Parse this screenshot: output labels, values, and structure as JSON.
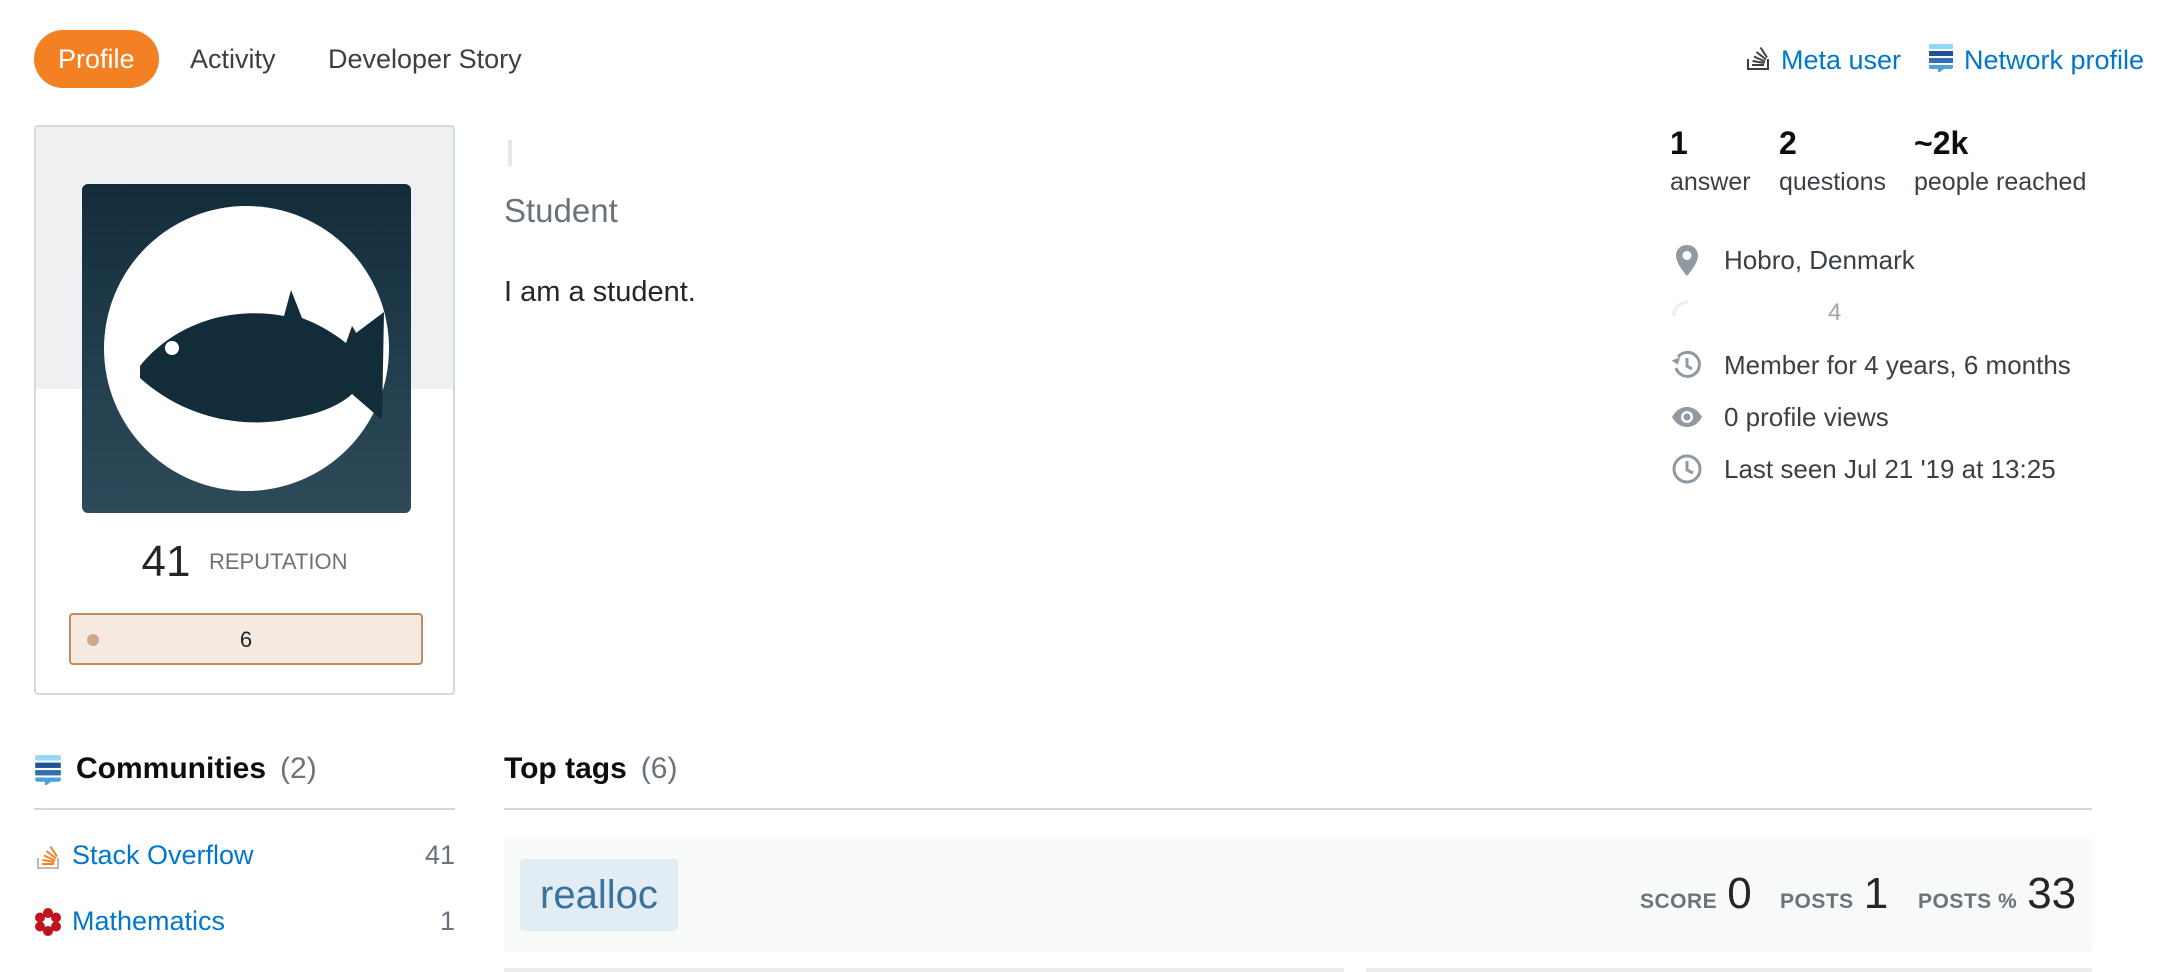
{
  "nav": {
    "tabs": [
      {
        "label": "Profile",
        "active": true
      },
      {
        "label": "Activity",
        "active": false
      },
      {
        "label": "Developer Story",
        "active": false
      }
    ],
    "meta_user": "Meta user",
    "network_profile": "Network profile"
  },
  "profile": {
    "title": "Student",
    "about": "I am a student.",
    "reputation": "41",
    "reputation_label": "REPUTATION",
    "bronze_badges": "6",
    "avatar_icon": "fish-icon"
  },
  "stats": [
    {
      "num": "1",
      "label": "answer"
    },
    {
      "num": "2",
      "label": "questions"
    },
    {
      "num": "~2k",
      "label": "people reached"
    }
  ],
  "info": {
    "location": "Hobro, Denmark",
    "website_partial": "4",
    "member_for": "Member for 4 years, 6 months",
    "profile_views": "0 profile views",
    "last_seen": "Last seen Jul 21 '19 at 13:25"
  },
  "communities": {
    "heading": "Communities",
    "count": "(2)",
    "items": [
      {
        "name": "Stack Overflow",
        "value": "41",
        "icon": "stackoverflow-icon"
      },
      {
        "name": "Mathematics",
        "value": "1",
        "icon": "mathematics-icon"
      }
    ]
  },
  "top_tags": {
    "heading": "Top tags",
    "count": "(6)",
    "items": [
      {
        "tag": "realloc",
        "score_label": "SCORE",
        "score": "0",
        "posts_label": "POSTS",
        "posts": "1",
        "posts_pct_label": "POSTS %",
        "posts_pct": "33"
      }
    ]
  },
  "colors": {
    "accent": "#f48024",
    "link": "#0077cc",
    "tag_bg": "#e1ecf4",
    "tag_text": "#39739d",
    "bronze": "#c38b5f"
  }
}
